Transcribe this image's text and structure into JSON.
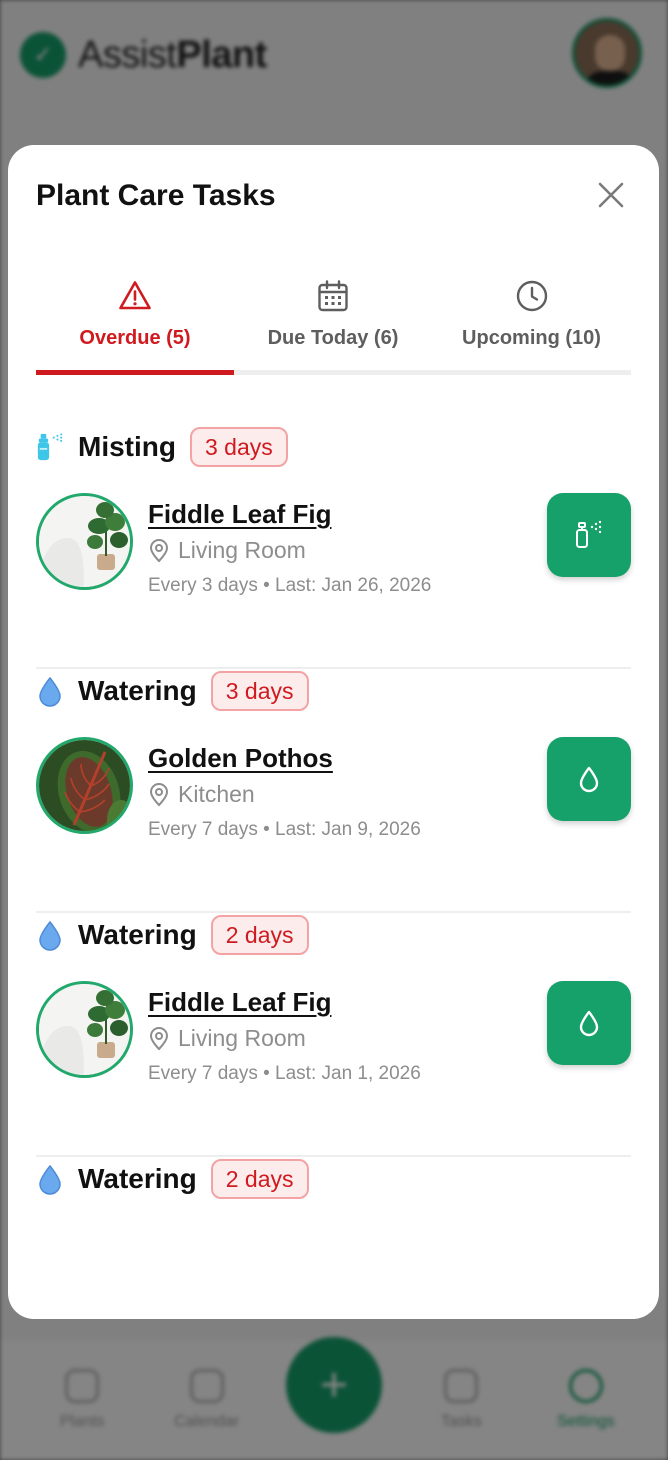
{
  "background": {
    "brand_light": "Assist",
    "brand_bold": "Plant",
    "nav": [
      {
        "label": "Plants"
      },
      {
        "label": "Calendar"
      },
      {
        "label": "Tasks"
      },
      {
        "label": "Settings"
      }
    ],
    "fab_label": "+"
  },
  "modal": {
    "title": "Plant Care Tasks",
    "close_icon": "close-icon"
  },
  "tabs": [
    {
      "label": "Overdue (5)",
      "icon": "warning-icon",
      "active": true
    },
    {
      "label": "Due Today (6)",
      "icon": "calendar-icon",
      "active": false
    },
    {
      "label": "Upcoming (10)",
      "icon": "clock-icon",
      "active": false
    }
  ],
  "tasks": [
    {
      "type": "Misting",
      "badge": "3 days",
      "plant": "Fiddle Leaf Fig",
      "location": "Living Room",
      "schedule": "Every 3 days • Last: Jan 26, 2026",
      "action_icon": "spray-bottle-icon"
    },
    {
      "type": "Watering",
      "badge": "3 days",
      "plant": "Golden Pothos",
      "location": "Kitchen",
      "schedule": "Every 7 days • Last: Jan 9, 2026",
      "action_icon": "water-drop-icon"
    },
    {
      "type": "Watering",
      "badge": "2 days",
      "plant": "Fiddle Leaf Fig",
      "location": "Living Room",
      "schedule": "Every 7 days • Last: Jan 1, 2026",
      "action_icon": "water-drop-icon"
    },
    {
      "type": "Watering",
      "badge": "2 days"
    }
  ],
  "colors": {
    "accent_green": "#16a06a",
    "overdue_red": "#cf1b1f",
    "badge_bg": "#fdecec",
    "badge_border": "#f3a3a3",
    "water_blue": "#5e9ee8",
    "mist_cyan": "#3ec6e8"
  }
}
